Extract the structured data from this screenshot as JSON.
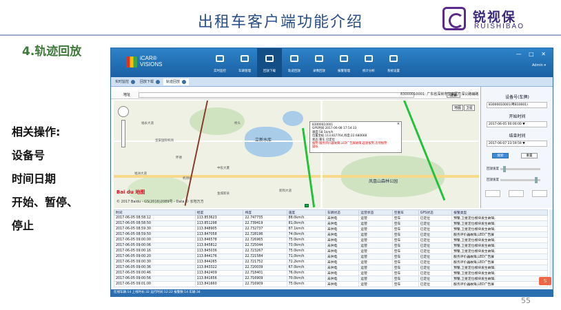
{
  "slide": {
    "title": "出租车客户端功能介绍",
    "section": "4.轨迹回放",
    "notes": [
      "相关操作:",
      "设备号",
      "时间日期",
      "开始、暂停、",
      "停止"
    ],
    "page_number": "55",
    "logo_cn": "锐视保",
    "logo_en": "RUISHIBAO"
  },
  "app": {
    "logo_text": "iCAR® VISIONS",
    "nav": [
      {
        "label": "实时监控",
        "icon": "camera-icon"
      },
      {
        "label": "车辆管理",
        "icon": "car-icon"
      },
      {
        "label": "回放下载",
        "icon": "download-icon",
        "active": true
      },
      {
        "label": "轨迹回放",
        "icon": "route-icon"
      },
      {
        "label": "录像回放",
        "icon": "video-icon"
      },
      {
        "label": "报警管理",
        "icon": "alarm-icon"
      },
      {
        "label": "统计分析",
        "icon": "chart-icon"
      },
      {
        "label": "系统设置",
        "icon": "settings-icon"
      }
    ],
    "window_controls": "— □ ✕",
    "user": "Admin ▾",
    "tabs": [
      {
        "label": "实时监控"
      },
      {
        "label": "回放下载"
      },
      {
        "label": "轨迹回放",
        "selected": true
      }
    ],
    "address_label": "地址",
    "address_value": "",
    "search_button": "搜索",
    "location_text": "83000010001: 广东省深圳市宝安区广深公路辅路",
    "map_type": [
      "地图",
      "卫星"
    ],
    "map_labels": [
      "立新水库",
      "凤凰山森林公园",
      "福洲大道",
      "福永大道",
      "桥头",
      "怀德",
      "新和大道",
      "金城新县",
      "中投大厦",
      "宝安国际机场",
      "机场城",
      "新锦大道"
    ],
    "map_brand": "Bai du 地图",
    "map_copyright": "© 2017 Baidu - GS(2016)2089号 - Data © 长地万方",
    "popup": {
      "device": "83000010001",
      "time": "GPS时间:2017-06-08 17:54:33",
      "speed": "速度:58.5km/h",
      "position": "位置坐标:113.837764,纬度:22.680668",
      "status": "状态:重车 已定位",
      "alarm": "报警:服务评价器故障,LED广告屏故障,超速报警,违停报警",
      "alarm2": "疑似"
    },
    "side": {
      "device_title": "设备号(车牌)",
      "device_value": "83000010001(粤B10001)",
      "start_title": "开始时间",
      "start_value": "2017-06-05 00:00:00 ▼",
      "end_title": "结束时间",
      "end_value": "2017-06-07 23:59:59 ▼",
      "search_btn": "搜索",
      "reset_btn": "重置",
      "speed_label": "回放速度",
      "playback_label": "回放速度"
    },
    "table": {
      "headers": [
        "时间",
        "经度",
        "纬度",
        "速度",
        "车辆状态",
        "运营状态",
        "空重车",
        "GPS状态",
        "报警类型"
      ],
      "rows": [
        [
          "2017-06-05 08:58:12",
          "113.853623",
          "22.747735",
          "88.0km/h",
          "未供电",
          "运营",
          "空车",
          "已定位",
          "预警,卫星定位模块发生故障,"
        ],
        [
          "2017-06-05 08:58:50",
          "113.851298",
          "22.739419",
          "81.0km/h",
          "未供电",
          "运营",
          "空车",
          "已定位",
          "预警,卫星定位模块发生故障,"
        ],
        [
          "2017-06-05 08:59:30",
          "113.848905",
          "22.732737",
          "87.1km/h",
          "未供电",
          "运营",
          "空车",
          "已定位",
          "预警,卫星定位模块发生故障,"
        ],
        [
          "2017-06-05 08:59:50",
          "113.847058",
          "22.728196",
          "74.0km/h",
          "未供电",
          "运营",
          "空车",
          "已定位",
          "服务评价器故障,LED广告屏"
        ],
        [
          "2017-06-05 09:00:00",
          "113.846578",
          "22.726965",
          "75.0km/h",
          "未供电",
          "运营",
          "空车",
          "已定位",
          "预警,卫星定位模块发生故障,"
        ],
        [
          "2017-06-05 09:00:06",
          "113.845812",
          "22.725044",
          "73.0km/h",
          "未供电",
          "运营",
          "空车",
          "已定位",
          "预警,卫星定位模块发生故障,"
        ],
        [
          "2017-06-05 09:00:16",
          "113.845036",
          "22.723267",
          "75.0km/h",
          "未供电",
          "运营",
          "空车",
          "已定位",
          "预警,卫星定位模块发生故障,"
        ],
        [
          "2017-06-05 09:00:20",
          "113.844176",
          "22.721584",
          "71.0km/h",
          "未供电",
          "运营",
          "空车",
          "已定位",
          "服务评价器故障,LED广告屏"
        ],
        [
          "2017-06-05 09:00:30",
          "113.844265",
          "22.721752",
          "72.2km/h",
          "未供电",
          "运营",
          "空车",
          "已定位",
          "服务评价器故障,LED广告屏"
        ],
        [
          "2017-06-05 09:00:36",
          "113.843322",
          "22.720039",
          "67.0km/h",
          "未供电",
          "运营",
          "空车",
          "已定位",
          "预警,卫星定位模块发生故障,"
        ],
        [
          "2017-06-05 09:00:46",
          "113.842409",
          "22.718401",
          "76.0km/h",
          "未供电",
          "运营",
          "空车",
          "已定位",
          "预警,卫星定位模块发生故障,"
        ],
        [
          "2017-06-05 09:00:56",
          "113.841656",
          "22.716909",
          "70.0km/h",
          "未供电",
          "运营",
          "空车",
          "已定位",
          "预警,卫星定位模块发生故障,"
        ],
        [
          "2017-06-05 09:01:00",
          "113.841660",
          "22.716909",
          "75.0km/h",
          "未供电",
          "运营",
          "空车",
          "已定位",
          "服务评价器故障,LED广告屏"
        ]
      ]
    },
    "statusbar": "在线车辆:14 上线时长:32 运行时间:12:22 报警数:14 车辆:34"
  },
  "colors": {
    "title": "#2a4f86",
    "section": "#3f7a3a",
    "topbar": "#1a5fa2",
    "track": "#22c23a",
    "alarm": "#dd1111"
  }
}
